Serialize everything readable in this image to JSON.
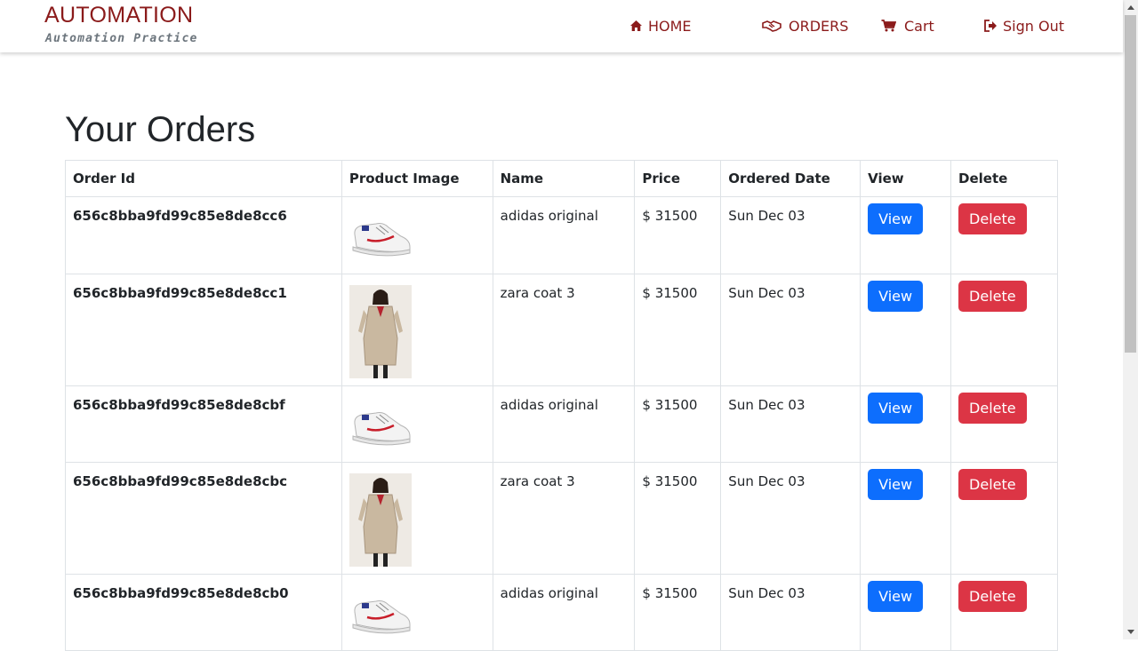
{
  "brand": {
    "title": "AUTOMATION",
    "subtitle": "Automation Practice"
  },
  "nav": {
    "home": "HOME",
    "orders": "ORDERS",
    "cart": "Cart",
    "sign_out": "Sign Out"
  },
  "page_title": "Your Orders",
  "table": {
    "headers": {
      "order_id": "Order Id",
      "product_image": "Product Image",
      "name": "Name",
      "price": "Price",
      "ordered_date": "Ordered Date",
      "view": "View",
      "delete": "Delete"
    },
    "rows": [
      {
        "order_id": "656c8bba9fd99c85e8de8cc6",
        "image": "shoe",
        "name": "adidas original",
        "price": "$ 31500",
        "date": "Sun Dec 03",
        "view": "View",
        "delete": "Delete"
      },
      {
        "order_id": "656c8bba9fd99c85e8de8cc1",
        "image": "coat",
        "name": "zara coat 3",
        "price": "$ 31500",
        "date": "Sun Dec 03",
        "view": "View",
        "delete": "Delete"
      },
      {
        "order_id": "656c8bba9fd99c85e8de8cbf",
        "image": "shoe",
        "name": "adidas original",
        "price": "$ 31500",
        "date": "Sun Dec 03",
        "view": "View",
        "delete": "Delete"
      },
      {
        "order_id": "656c8bba9fd99c85e8de8cbc",
        "image": "coat",
        "name": "zara coat 3",
        "price": "$ 31500",
        "date": "Sun Dec 03",
        "view": "View",
        "delete": "Delete"
      },
      {
        "order_id": "656c8bba9fd99c85e8de8cb0",
        "image": "shoe",
        "name": "adidas original",
        "price": "$ 31500",
        "date": "Sun Dec 03",
        "view": "View",
        "delete": "Delete"
      }
    ]
  },
  "colors": {
    "brand": "#8b1b1b",
    "view_button": "#0d6efd",
    "delete_button": "#dc3545"
  },
  "icons": {
    "home": "home-icon",
    "orders": "handshake-icon",
    "cart": "cart-icon",
    "sign_out": "sign-out-icon"
  }
}
